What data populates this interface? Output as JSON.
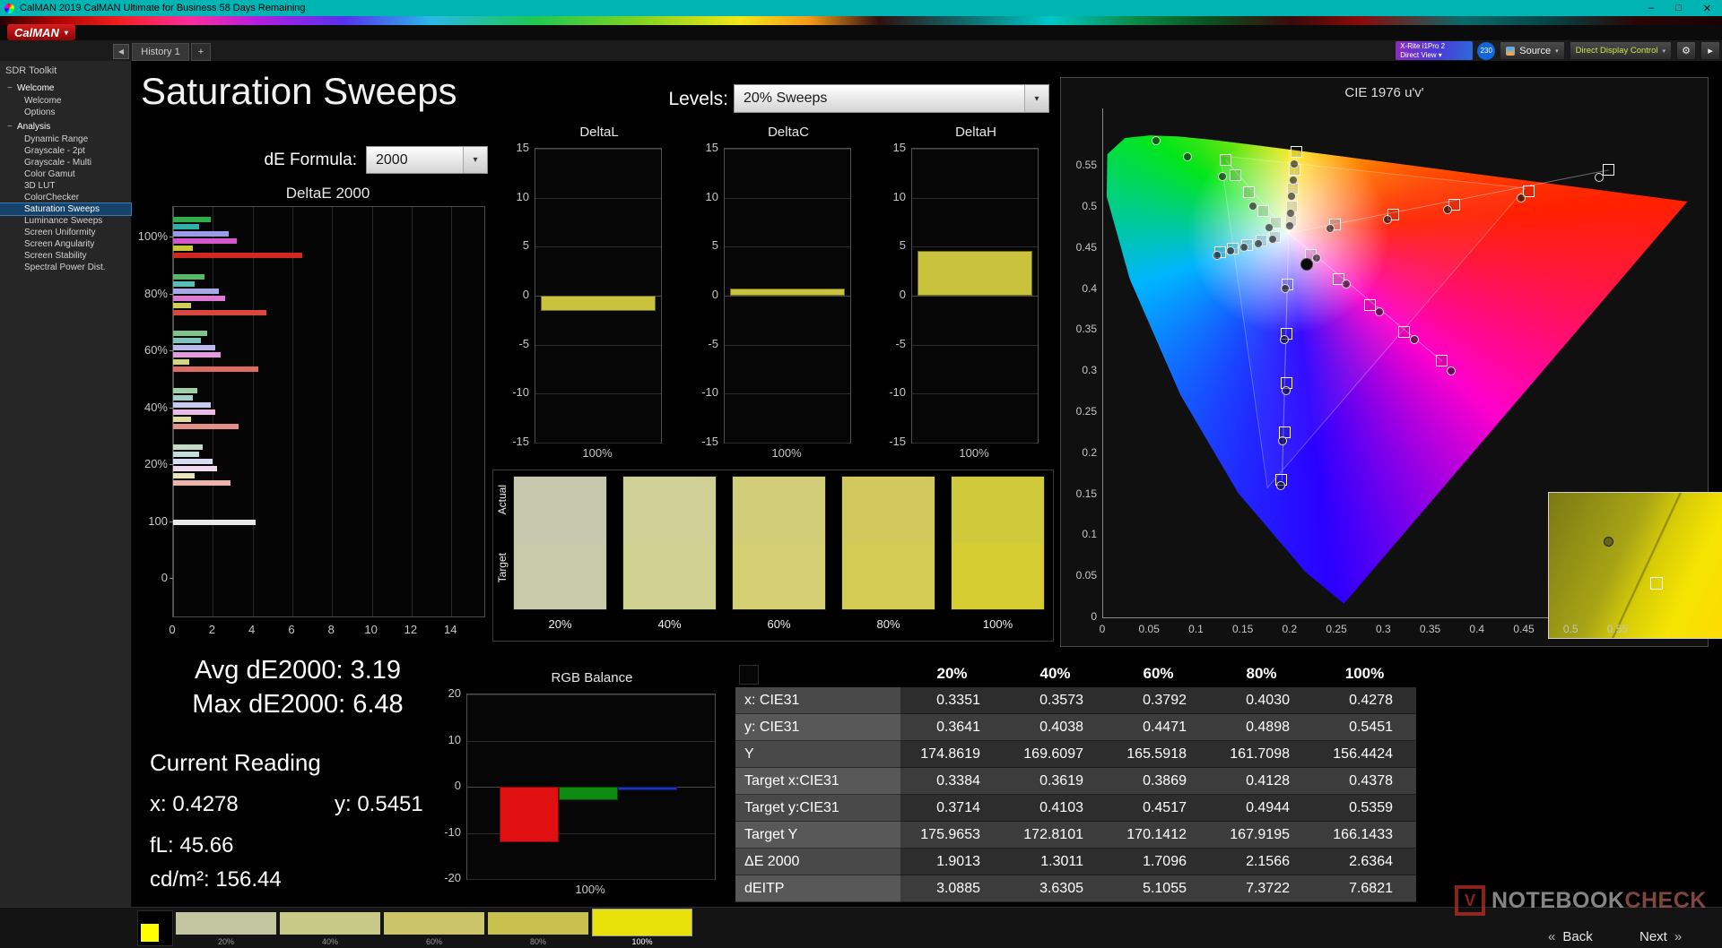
{
  "title_bar": {
    "title": "CalMAN 2019 CalMAN Ultimate for Business 58 Days Remaining",
    "minimize": "–",
    "maximize": "□",
    "close": "✕"
  },
  "logo": {
    "text": "CalMAN",
    "caret": "▾"
  },
  "tab_bar": {
    "collapse": "◀",
    "tabs": [
      {
        "label": "History 1"
      }
    ],
    "add_tab": "+"
  },
  "toolbar": {
    "meter_line1": "X-Rite i1Pro 2",
    "meter_line2": "Direct View ▾",
    "badge": "230",
    "source": "Source",
    "display_control": "Direct Display Control",
    "gear": "⚙",
    "expand": "▸"
  },
  "sidebar": {
    "header": "SDR Toolkit",
    "groups": [
      {
        "label": "Welcome",
        "items": [
          {
            "label": "Welcome"
          },
          {
            "label": "Options"
          }
        ]
      },
      {
        "label": "Analysis",
        "items": [
          {
            "label": "Dynamic Range"
          },
          {
            "label": "Grayscale - 2pt"
          },
          {
            "label": "Grayscale - Multi"
          },
          {
            "label": "Color Gamut"
          },
          {
            "label": "3D LUT"
          },
          {
            "label": "ColorChecker"
          },
          {
            "label": "Saturation Sweeps",
            "selected": true
          },
          {
            "label": "Luminance Sweeps"
          },
          {
            "label": "Screen Uniformity"
          },
          {
            "label": "Screen Angularity"
          },
          {
            "label": "Screen Stability"
          },
          {
            "label": "Spectral Power Dist."
          }
        ]
      }
    ]
  },
  "page": {
    "title": "Saturation Sweeps",
    "levels_label": "Levels:",
    "levels_value": "20% Sweeps",
    "de_formula_label": "dE Formula:",
    "de_formula_value": "2000"
  },
  "stats": {
    "avg": "Avg dE2000: 3.19",
    "max": "Max dE2000: 6.48",
    "current_heading": "Current Reading",
    "x": "x: 0.4278",
    "y": "y: 0.5451",
    "fl": "fL: 45.66",
    "cdm2": "cd/m²: 156.44"
  },
  "swatch_panel": {
    "row_labels": [
      "Actual",
      "Target"
    ],
    "swatches": [
      {
        "label": "20%",
        "actual": "#c6c9ad",
        "target": "#c8cba9"
      },
      {
        "label": "40%",
        "actual": "#ced096",
        "target": "#d0d291"
      },
      {
        "label": "60%",
        "actual": "#d2cd79",
        "target": "#d4cf72"
      },
      {
        "label": "80%",
        "actual": "#d1c95c",
        "target": "#d3cb54"
      },
      {
        "label": "100%",
        "actual": "#d1c93c",
        "target": "#d4cc30"
      }
    ]
  },
  "table": {
    "columns": [
      "",
      "20%",
      "40%",
      "60%",
      "80%",
      "100%"
    ],
    "rows": [
      {
        "label": "x: CIE31",
        "values": [
          "0.3351",
          "0.3573",
          "0.3792",
          "0.4030",
          "0.4278"
        ]
      },
      {
        "label": "y: CIE31",
        "values": [
          "0.3641",
          "0.4038",
          "0.4471",
          "0.4898",
          "0.5451"
        ]
      },
      {
        "label": "Y",
        "values": [
          "174.8619",
          "169.6097",
          "165.5918",
          "161.7098",
          "156.4424"
        ]
      },
      {
        "label": "Target x:CIE31",
        "values": [
          "0.3384",
          "0.3619",
          "0.3869",
          "0.4128",
          "0.4378"
        ]
      },
      {
        "label": "Target y:CIE31",
        "values": [
          "0.3714",
          "0.4103",
          "0.4517",
          "0.4944",
          "0.5359"
        ]
      },
      {
        "label": "Target Y",
        "values": [
          "175.9653",
          "172.8101",
          "170.1412",
          "167.9195",
          "166.1433"
        ]
      },
      {
        "label": "ΔE 2000",
        "values": [
          "1.9013",
          "1.3011",
          "1.7096",
          "2.1566",
          "2.6364"
        ]
      },
      {
        "label": "dEITP",
        "values": [
          "3.0885",
          "3.6305",
          "5.1055",
          "7.3722",
          "7.6821"
        ]
      }
    ]
  },
  "bottom_bar": {
    "indicator_color": "#ffff00",
    "tiles": [
      {
        "label": "20%",
        "color": "#c3c5a0"
      },
      {
        "label": "40%",
        "color": "#c9c987"
      },
      {
        "label": "60%",
        "color": "#cbc468"
      },
      {
        "label": "80%",
        "color": "#c9c14e"
      },
      {
        "label": "100%",
        "color": "#e8e20a",
        "selected": true
      }
    ]
  },
  "footer": {
    "back": "Back",
    "next": "Next",
    "back_chevron": "«",
    "next_chevron": "»",
    "watermark_a": "NOTEBOOK",
    "watermark_b": "CHECK",
    "watermark_logo": "V"
  },
  "chart_data": [
    {
      "id": "deltaE2000",
      "type": "bar",
      "orientation": "horizontal",
      "title": "DeltaE 2000",
      "xlabel": "",
      "ylabel": "",
      "xlim": [
        0,
        14
      ],
      "x_draw_max": 15.66,
      "x_ticks": [
        0,
        2,
        4,
        6,
        8,
        10,
        12,
        14
      ],
      "groups": [
        {
          "label": "100%",
          "bars": [
            {
              "color": "#2fae4a",
              "value": 1.9
            },
            {
              "color": "#2fb0a8",
              "value": 1.3
            },
            {
              "color": "#9a9ae6",
              "value": 2.8
            },
            {
              "color": "#d455cc",
              "value": 3.2
            },
            {
              "color": "#c8c834",
              "value": 1.0
            },
            {
              "color": "#d02820",
              "value": 6.48
            }
          ]
        },
        {
          "label": "80%",
          "bars": [
            {
              "color": "#58b86a",
              "value": 1.6
            },
            {
              "color": "#58bcb2",
              "value": 1.1
            },
            {
              "color": "#a8aae8",
              "value": 2.3
            },
            {
              "color": "#dd7ad4",
              "value": 2.6
            },
            {
              "color": "#cfcf5a",
              "value": 0.9
            },
            {
              "color": "#d84840",
              "value": 4.7
            }
          ]
        },
        {
          "label": "60%",
          "bars": [
            {
              "color": "#7cc48a",
              "value": 1.7
            },
            {
              "color": "#7cc6be",
              "value": 1.4
            },
            {
              "color": "#b8baec",
              "value": 2.1
            },
            {
              "color": "#e49ade",
              "value": 2.4
            },
            {
              "color": "#d6d67e",
              "value": 0.8
            },
            {
              "color": "#de6c62",
              "value": 4.3
            }
          ]
        },
        {
          "label": "40%",
          "bars": [
            {
              "color": "#a0d0a8",
              "value": 1.2
            },
            {
              "color": "#a0d2ca",
              "value": 1.0
            },
            {
              "color": "#c8caf0",
              "value": 1.9
            },
            {
              "color": "#ecbae6",
              "value": 2.1
            },
            {
              "color": "#dede9e",
              "value": 0.9
            },
            {
              "color": "#e49088",
              "value": 3.3
            }
          ]
        },
        {
          "label": "20%",
          "bars": [
            {
              "color": "#c4dcc6",
              "value": 1.5
            },
            {
              "color": "#c4dedb",
              "value": 1.3
            },
            {
              "color": "#dadcf4",
              "value": 2.0
            },
            {
              "color": "#f2d8ee",
              "value": 2.2
            },
            {
              "color": "#e6e6c0",
              "value": 1.1
            },
            {
              "color": "#ecb4ac",
              "value": 2.9
            }
          ]
        },
        {
          "label": "100",
          "bars": [
            {
              "color": "#e8e8e8",
              "value": 4.15
            }
          ]
        },
        {
          "label": "0",
          "bars": []
        }
      ]
    },
    {
      "id": "deltaL",
      "type": "bar",
      "title": "DeltaL",
      "ylim": [
        -15,
        15
      ],
      "yticks": [
        15,
        10,
        5,
        0,
        -5,
        -10,
        -15
      ],
      "x_categories": [
        "100%"
      ],
      "bars": [
        {
          "color": "#c8c23c",
          "border": "#6f6b18",
          "value": -1.6
        }
      ]
    },
    {
      "id": "deltaC",
      "type": "bar",
      "title": "DeltaC",
      "ylim": [
        -15,
        15
      ],
      "yticks": [
        15,
        10,
        5,
        0,
        -5,
        -10,
        -15
      ],
      "x_categories": [
        "100%"
      ],
      "bars": [
        {
          "color": "#c8c23c",
          "border": "#6f6b18",
          "value": 0.7
        }
      ]
    },
    {
      "id": "deltaH",
      "type": "bar",
      "title": "DeltaH",
      "ylim": [
        -15,
        15
      ],
      "yticks": [
        15,
        10,
        5,
        0,
        -5,
        -10,
        -15
      ],
      "x_categories": [
        "100%"
      ],
      "bars": [
        {
          "color": "#c8c23c",
          "border": "#6f6b18",
          "value": 4.6
        }
      ]
    },
    {
      "id": "rgb_balance",
      "type": "bar",
      "title": "RGB Balance",
      "ylim": [
        -20,
        20
      ],
      "yticks": [
        20,
        10,
        0,
        -10,
        -20
      ],
      "x_categories": [
        "100%"
      ],
      "bars": [
        {
          "name": "red",
          "color": "#e01010",
          "border": "#7a0808",
          "value": -12
        },
        {
          "name": "green",
          "color": "#0e8a12",
          "border": "#064a08",
          "value": -3
        },
        {
          "name": "blue",
          "color": "#2030c0",
          "border": "#101a66",
          "value": -0.8
        }
      ]
    },
    {
      "id": "cie",
      "type": "scatter",
      "title": "CIE 1976 u'v'",
      "xlim": [
        0,
        0.63
      ],
      "ylim": [
        0,
        0.62
      ],
      "x_ticks": [
        "0",
        "0.05",
        "0.1",
        "0.15",
        "0.2",
        "0.25",
        "0.3",
        "0.35",
        "0.4",
        "0.45",
        "0.5",
        "0.55"
      ],
      "y_ticks": [
        "0",
        "0.05",
        "0.1",
        "0.15",
        "0.2",
        "0.25",
        "0.3",
        "0.35",
        "0.4",
        "0.45",
        "0.5",
        "0.55"
      ],
      "white_point": [
        0.198,
        0.468
      ],
      "gamut_triangle": [
        [
          0.4507,
          0.5229
        ],
        [
          0.125,
          0.5625
        ],
        [
          0.1754,
          0.1579
        ]
      ],
      "sweep_lines": [
        {
          "name": "red",
          "to": [
            0.54,
            0.545
          ]
        },
        {
          "name": "green",
          "to": [
            0.131,
            0.557
          ]
        },
        {
          "name": "blue",
          "to": [
            0.191,
            0.167
          ]
        },
        {
          "name": "cyan",
          "to": [
            0.125,
            0.444
          ]
        },
        {
          "name": "magenta",
          "to": [
            0.362,
            0.312
          ]
        },
        {
          "name": "yellow",
          "to": [
            0.207,
            0.567
          ]
        }
      ],
      "target_points": [
        [
          0.248,
          0.478
        ],
        [
          0.31,
          0.49
        ],
        [
          0.375,
          0.502
        ],
        [
          0.455,
          0.518
        ],
        [
          0.54,
          0.545
        ],
        [
          0.185,
          0.48
        ],
        [
          0.171,
          0.494
        ],
        [
          0.156,
          0.517
        ],
        [
          0.142,
          0.538
        ],
        [
          0.131,
          0.557
        ],
        [
          0.197,
          0.405
        ],
        [
          0.196,
          0.345
        ],
        [
          0.196,
          0.285
        ],
        [
          0.194,
          0.225
        ],
        [
          0.191,
          0.167
        ],
        [
          0.184,
          0.463
        ],
        [
          0.169,
          0.458
        ],
        [
          0.154,
          0.453
        ],
        [
          0.139,
          0.449
        ],
        [
          0.125,
          0.444
        ],
        [
          0.222,
          0.441
        ],
        [
          0.252,
          0.412
        ],
        [
          0.285,
          0.38
        ],
        [
          0.322,
          0.347
        ],
        [
          0.362,
          0.312
        ],
        [
          0.201,
          0.482
        ],
        [
          0.202,
          0.5
        ],
        [
          0.203,
          0.522
        ],
        [
          0.205,
          0.545
        ],
        [
          0.207,
          0.567
        ]
      ],
      "measured_points": [
        [
          0.243,
          0.473
        ],
        [
          0.304,
          0.484
        ],
        [
          0.368,
          0.496
        ],
        [
          0.447,
          0.51
        ],
        [
          0.53,
          0.535
        ],
        [
          0.178,
          0.474
        ],
        [
          0.16,
          0.5
        ],
        [
          0.128,
          0.536
        ],
        [
          0.09,
          0.56
        ],
        [
          0.057,
          0.58
        ],
        [
          0.195,
          0.4
        ],
        [
          0.194,
          0.338
        ],
        [
          0.196,
          0.276
        ],
        [
          0.192,
          0.215
        ],
        [
          0.19,
          0.16
        ],
        [
          0.181,
          0.46
        ],
        [
          0.166,
          0.455
        ],
        [
          0.151,
          0.45
        ],
        [
          0.136,
          0.446
        ],
        [
          0.122,
          0.44
        ],
        [
          0.228,
          0.437
        ],
        [
          0.26,
          0.405
        ],
        [
          0.295,
          0.372
        ],
        [
          0.333,
          0.338
        ],
        [
          0.372,
          0.3
        ],
        [
          0.2,
          0.476
        ],
        [
          0.201,
          0.492
        ],
        [
          0.202,
          0.512
        ],
        [
          0.203,
          0.532
        ],
        [
          0.204,
          0.552
        ]
      ],
      "current_point": [
        0.217,
        0.43
      ]
    }
  ]
}
